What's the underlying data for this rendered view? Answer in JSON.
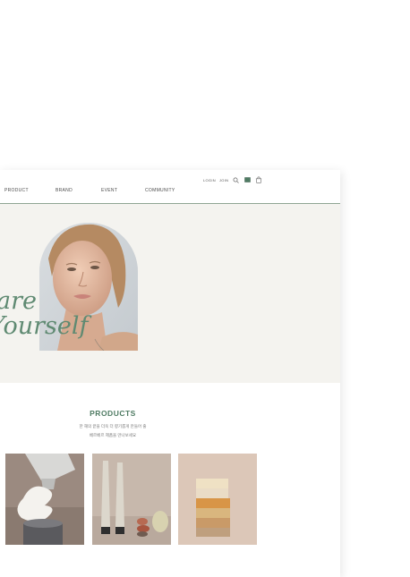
{
  "nav": {
    "items": [
      "PRODUCT",
      "BRAND",
      "EVENT",
      "COMMUNITY"
    ],
    "login": "LOGIN",
    "join": "JOIN",
    "icons": [
      "search-icon",
      "card-icon",
      "bag-icon"
    ]
  },
  "hero": {
    "line1": "are",
    "line2": "Yourself"
  },
  "products": {
    "title": "PRODUCTS",
    "desc1": "한 해의 끝을 더욱 더 향기롭게 만들어 줄",
    "desc2": "베르베르 제품을 만나보세요",
    "thumbnails": [
      "tube-product-image",
      "pen-product-image",
      "soap-stack-image"
    ]
  },
  "colors": {
    "accent": "#5f8a72",
    "hero_bg": "#f4f3ef",
    "divider": "#8fa593"
  }
}
